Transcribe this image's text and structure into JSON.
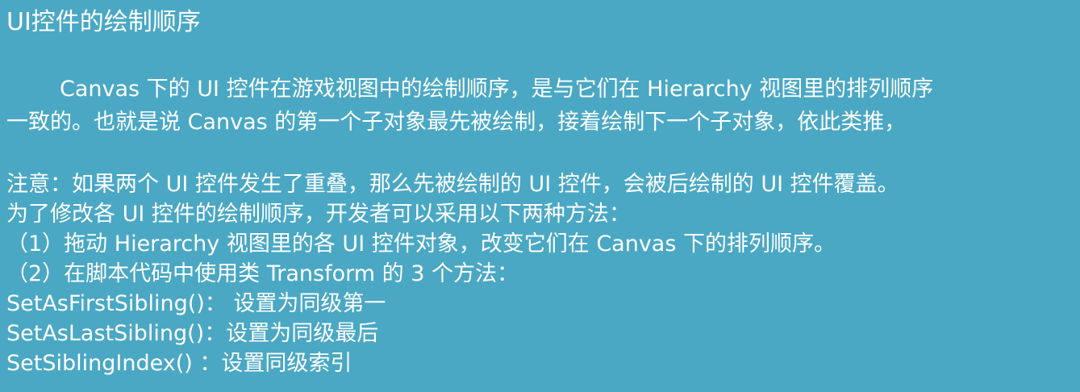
{
  "slide": {
    "title": "UI控件的绘制顺序",
    "paragraph1": {
      "line1": "Canvas 下的 UI 控件在游戏视图中的绘制顺序，是与它们在 Hierarchy 视图里的排列顺序",
      "line2": "一致的。也就是说 Canvas 的第一个子对象最先被绘制，接着绘制下一个子对象，依此类推，"
    },
    "note": "注意：如果两个 UI 控件发生了重叠，那么先被绘制的 UI 控件，会被后绘制的 UI 控件覆盖。",
    "methods_intro": "为了修改各 UI 控件的绘制顺序，开发者可以采用以下两种方法：",
    "method1": "（1）拖动 Hierarchy 视图里的各 UI 控件对象，改变它们在 Canvas 下的排列顺序。",
    "method2": "（2）在脚本代码中使用类 Transform 的 3 个方法：",
    "api_list": [
      "SetAsFirstSibling()： 设置为同级第一",
      "SetAsLastSibling()：设置为同级最后",
      "SetSiblingIndex() ：设置同级索引"
    ]
  }
}
